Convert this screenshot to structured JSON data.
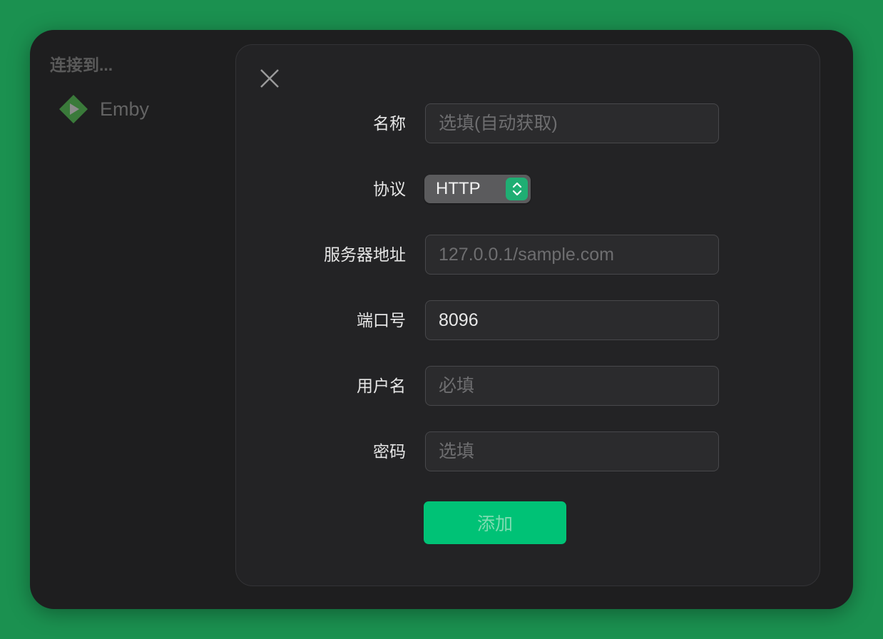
{
  "sidebar": {
    "title": "连接到...",
    "items": [
      {
        "label": "Emby",
        "icon": "emby-logo-icon"
      }
    ]
  },
  "form": {
    "name": {
      "label": "名称",
      "value": "",
      "placeholder": "选填(自动获取)"
    },
    "protocol": {
      "label": "协议",
      "value": "HTTP"
    },
    "server": {
      "label": "服务器地址",
      "value": "",
      "placeholder": "127.0.0.1/sample.com"
    },
    "port": {
      "label": "端口号",
      "value": "8096",
      "placeholder": ""
    },
    "username": {
      "label": "用户名",
      "value": "",
      "placeholder": "必填"
    },
    "password": {
      "label": "密码",
      "value": "",
      "placeholder": "选填"
    },
    "submit_label": "添加"
  },
  "colors": {
    "background": "#1b9150",
    "accent": "#00c276"
  }
}
